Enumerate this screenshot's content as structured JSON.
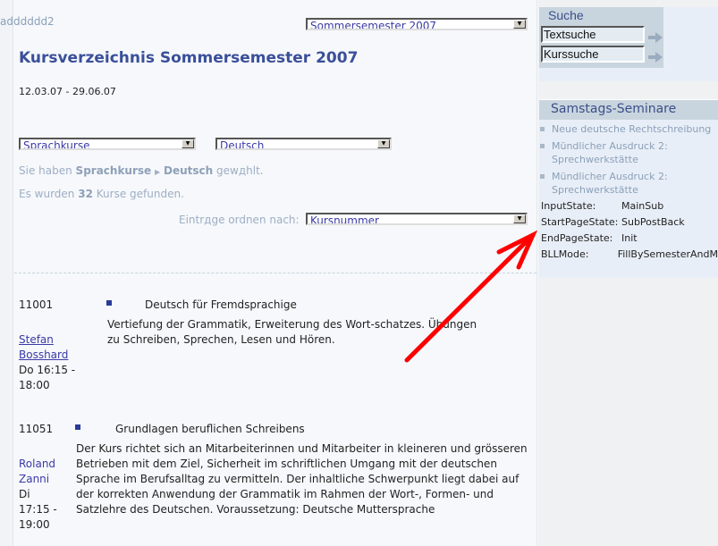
{
  "header": {
    "id_text": "adddddd2",
    "semester_select": "Sommersemester 2007",
    "title": "Kursverzeichnis Sommersemester 2007",
    "dates": "12.03.07 - 29.06.07"
  },
  "filters": {
    "category_select": "Sprachkurse",
    "language_select": "Deutsch",
    "selection_prefix": "Sie haben",
    "selection_category": "Sprachkurse",
    "selection_language": "Deutsch",
    "selection_suffix": "gewдhlt.",
    "found_prefix": "Es wurden",
    "found_count": "32",
    "found_suffix": "Kurse gefunden.",
    "sort_label": "Eintrдge ordnen nach:",
    "sort_select": "Kursnummer"
  },
  "courses": [
    {
      "number": "11001",
      "title": "Deutsch für Fremdsprachige",
      "teacher_first": "Stefan",
      "teacher_last": "Bosshard",
      "time1": "Do 16:15 -",
      "time2": "18:00",
      "description": "Vertiefung der Grammatik, Erweiterung des Wort-schatzes. Übungen zu Schreiben, Sprechen, Lesen und Hören."
    },
    {
      "number": "11051",
      "title": "Grundlagen beruflichen Schreibens",
      "teacher_first": "Roland",
      "teacher_last": "Zanni",
      "time0": "Di",
      "time1": "17:15 -",
      "time2": "19:00",
      "description": "Der Kurs richtet sich an Mitarbeiterinnen und Mitarbeiter in kleineren und grösseren Betrieben mit dem Ziel, Sicherheit im schriftlichen Umgang mit der deutschen Sprache im Berufsalltag zu vermitteln. Der inhaltliche Schwerpunkt liegt dabei auf der korrekten Anwendung der Grammatik im Rahmen der Wort-, Formen- und Satzlehre des Deutschen. Voraussetzung: Deutsche Muttersprache"
    }
  ],
  "sidebar": {
    "search_title": "Suche",
    "text_search": "Textsuche",
    "course_search": "Kurssuche",
    "seminars_title": "Samstags-Seminare",
    "seminars": [
      {
        "label": "Neue deutsche Rechtschreibung"
      },
      {
        "label": "Mündlicher Ausdruck 2: Sprechwerkstätte"
      },
      {
        "label": "Mündlicher Ausdruck 2: Sprechwerkstätte"
      }
    ],
    "debug": [
      {
        "key": "InputState:",
        "value": "MainSub"
      },
      {
        "key": "StartPageState:",
        "value": "SubPostBack"
      },
      {
        "key": "EndPageState:",
        "value": "Init"
      },
      {
        "key": "BLLMode:",
        "value": "FillBySemesterAndM"
      }
    ]
  },
  "colors": {
    "title": "#3a4f9a",
    "annotation_arrow": "#ff0000",
    "sidebar_header": "#c9d5de"
  }
}
